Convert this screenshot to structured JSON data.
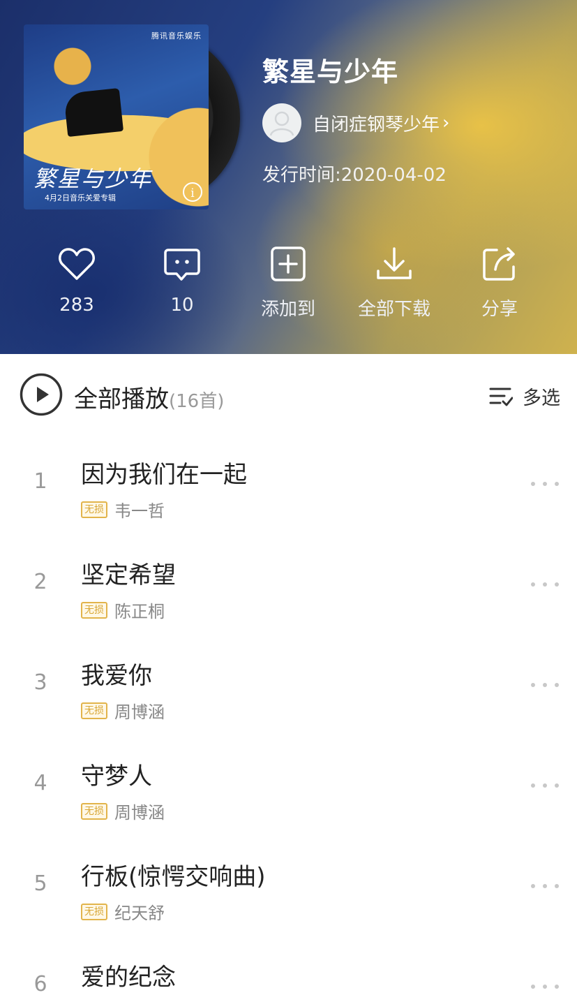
{
  "album": {
    "title": "繁星与少年",
    "artist": "自闭症钢琴少年",
    "release": "发行时间:2020-04-02",
    "cover_brand": "腾讯音乐娱乐",
    "cover_title": "繁星与少年",
    "cover_subtitle": "4月2日音乐关爱专辑"
  },
  "actions": [
    {
      "name": "like",
      "icon": "heart-icon",
      "label": "283"
    },
    {
      "name": "comment",
      "icon": "comment-icon",
      "label": "10"
    },
    {
      "name": "add-to",
      "icon": "add-box-icon",
      "label": "添加到"
    },
    {
      "name": "download-all",
      "icon": "download-icon",
      "label": "全部下载"
    },
    {
      "name": "share",
      "icon": "share-icon",
      "label": "分享"
    }
  ],
  "play_all": {
    "label": "全部播放",
    "count": "(16首)",
    "multi_select": "多选"
  },
  "badge_text": "无损",
  "songs": [
    {
      "num": "1",
      "title": "因为我们在一起",
      "singer": "韦一哲"
    },
    {
      "num": "2",
      "title": "坚定希望",
      "singer": "陈正桐"
    },
    {
      "num": "3",
      "title": "我爱你",
      "singer": "周博涵"
    },
    {
      "num": "4",
      "title": "守梦人",
      "singer": "周博涵"
    },
    {
      "num": "5",
      "title": "行板(惊愕交响曲)",
      "singer": "纪天舒"
    },
    {
      "num": "6",
      "title": "爱的纪念",
      "singer": ""
    }
  ],
  "colors": {
    "header_blue": "#1b2f6a",
    "header_gold": "#cfb24e",
    "badge_gold": "#e2b44b"
  }
}
